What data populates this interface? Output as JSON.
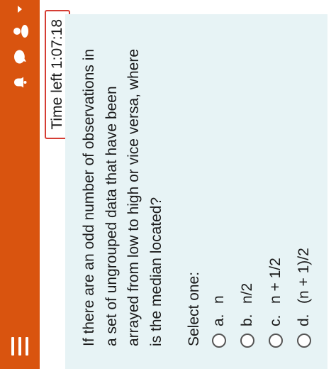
{
  "header": {
    "menu_icon": "hamburger-menu-icon",
    "icons": [
      "bell-icon",
      "chat-bubble-icon",
      "user-avatar-icon",
      "dropdown-caret-icon"
    ],
    "accent_color": "#d9540f"
  },
  "timer": {
    "text": "Time left 1:07:18"
  },
  "question": {
    "text": "If there are an odd number of observations in a set of ungrouped data that have been arrayed from low to high or vice versa, where is the median located?",
    "select_label": "Select one:",
    "options": [
      {
        "letter": "a.",
        "text": "n"
      },
      {
        "letter": "b.",
        "text": "n/2"
      },
      {
        "letter": "c.",
        "text": "n + 1/2"
      },
      {
        "letter": "d.",
        "text": "(n + 1)/2"
      }
    ]
  }
}
